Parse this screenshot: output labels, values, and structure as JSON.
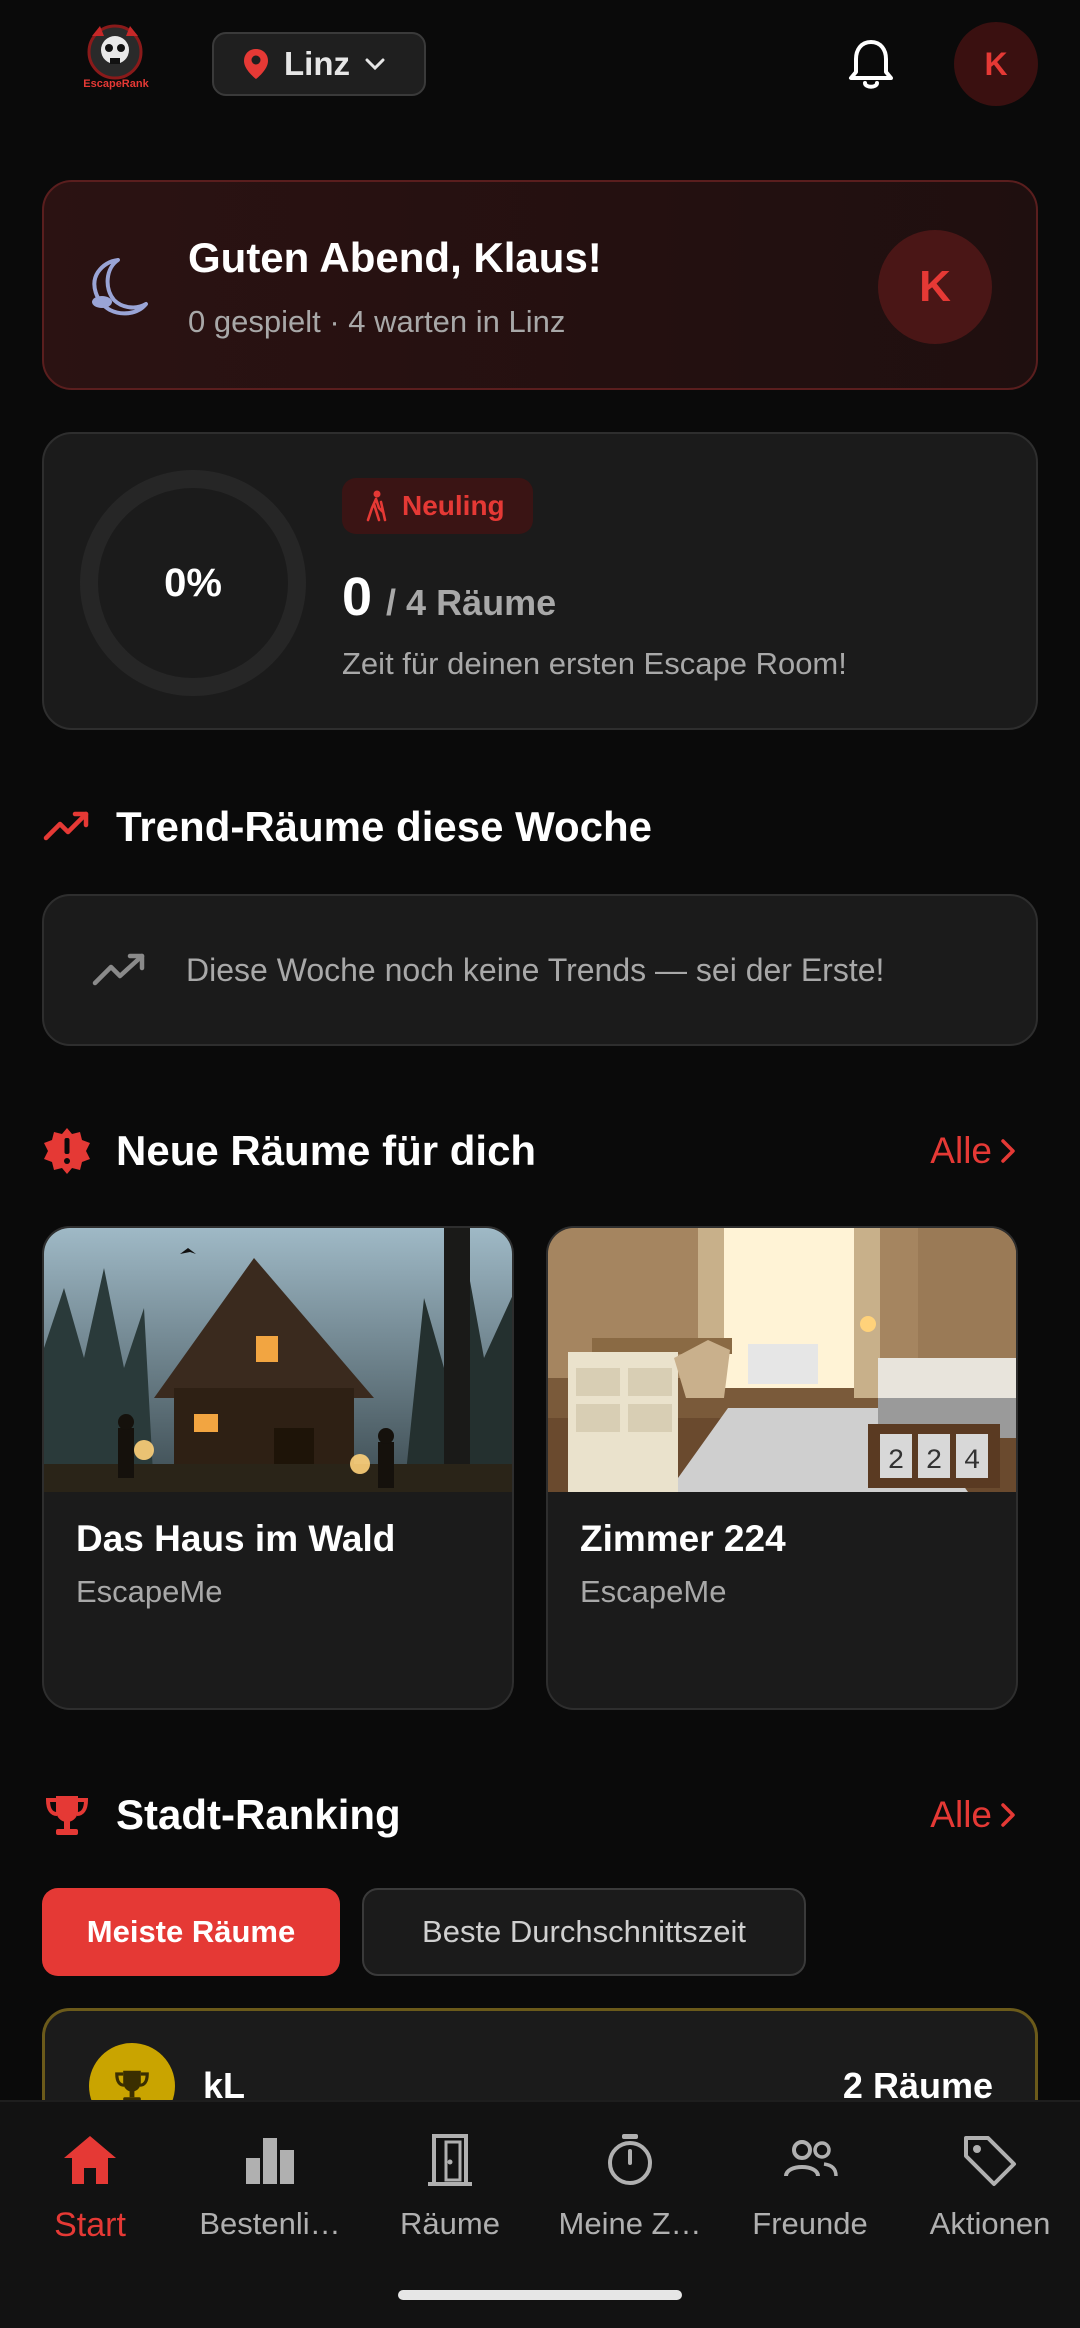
{
  "header": {
    "logo_text": "EscapeRank",
    "city": "Linz",
    "avatar_initial": "K"
  },
  "greeting": {
    "title": "Guten Abend, Klaus!",
    "subtitle": "0 gespielt · 4 warten in Linz",
    "avatar_initial": "K"
  },
  "progress": {
    "percent_label": "0%",
    "percent_value": 0,
    "badge": "Neuling",
    "played": "0",
    "total_label": "/ 4 Räume",
    "hint": "Zeit für deinen ersten Escape Room!"
  },
  "trends": {
    "title": "Trend-Räume diese Woche",
    "empty_message": "Diese Woche noch keine Trends — sei der Erste!"
  },
  "new_rooms": {
    "title": "Neue Räume für dich",
    "all_label": "Alle",
    "items": [
      {
        "name": "Das Haus im Wald",
        "provider": "EscapeMe"
      },
      {
        "name": "Zimmer 224",
        "provider": "EscapeMe"
      }
    ]
  },
  "ranking": {
    "title": "Stadt-Ranking",
    "all_label": "Alle",
    "tabs": [
      "Meiste Räume",
      "Beste Durchschnittszeit"
    ],
    "rows": [
      {
        "name": "kL",
        "count": "2 Räume"
      }
    ]
  },
  "nav": {
    "items": [
      "Start",
      "Bestenli…",
      "Räume",
      "Meine Z…",
      "Freunde",
      "Aktionen"
    ]
  },
  "colors": {
    "accent": "#e53935",
    "background": "#0a0a0a",
    "card": "#1b1b1b",
    "gold": "#c9a400"
  }
}
